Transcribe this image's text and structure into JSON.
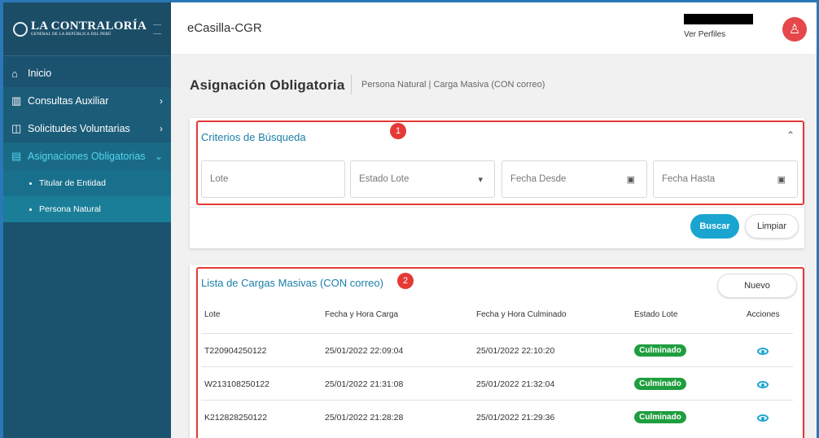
{
  "logo": {
    "main": "LA CONTRALORÍA",
    "sub": "GENERAL DE LA REPÚBLICA DEL PERÚ"
  },
  "header": {
    "app_title": "eCasilla-CGR",
    "profile_link": "Ver Perfiles"
  },
  "sidebar": {
    "items": [
      {
        "label": "Inicio",
        "icon": "home-icon"
      },
      {
        "label": "Consultas Auxiliar",
        "icon": "bar-chart-icon"
      },
      {
        "label": "Solicitudes Voluntarias",
        "icon": "window-icon"
      },
      {
        "label": "Asignaciones Obligatorias",
        "icon": "clipboard-icon"
      }
    ],
    "subitems": [
      {
        "label": "Titular de Entidad"
      },
      {
        "label": "Persona Natural"
      }
    ]
  },
  "page": {
    "title": "Asignación Obligatoria",
    "subtitle": "Persona Natural | Carga Masiva (CON correo)"
  },
  "search": {
    "title": "Criterios de Búsqueda",
    "badge": "1",
    "fields": {
      "lote": "Lote",
      "estado": "Estado Lote",
      "desde": "Fecha Desde",
      "hasta": "Fecha Hasta"
    },
    "buscar": "Buscar",
    "limpiar": "Limpiar"
  },
  "list": {
    "title": "Lista de Cargas Masivas (CON correo)",
    "badge": "2",
    "nuevo": "Nuevo",
    "columns": [
      "Lote",
      "Fecha y Hora Carga",
      "Fecha y Hora Culminado",
      "Estado Lote",
      "Acciones"
    ],
    "rows": [
      {
        "lote": "T220904250122",
        "carga": "25/01/2022 22:09:04",
        "culminado": "25/01/2022 22:10:20",
        "estado": "Culminado"
      },
      {
        "lote": "W213108250122",
        "carga": "25/01/2022 21:31:08",
        "culminado": "25/01/2022 21:32:04",
        "estado": "Culminado"
      },
      {
        "lote": "K212828250122",
        "carga": "25/01/2022 21:28:28",
        "culminado": "25/01/2022 21:29:36",
        "estado": "Culminado"
      }
    ]
  },
  "colors": {
    "sidebar": "#1a5270",
    "accent": "#1aa5d0",
    "status_green": "#1f9e3f",
    "highlight_red": "#e53935",
    "avatar": "#e5474a"
  }
}
